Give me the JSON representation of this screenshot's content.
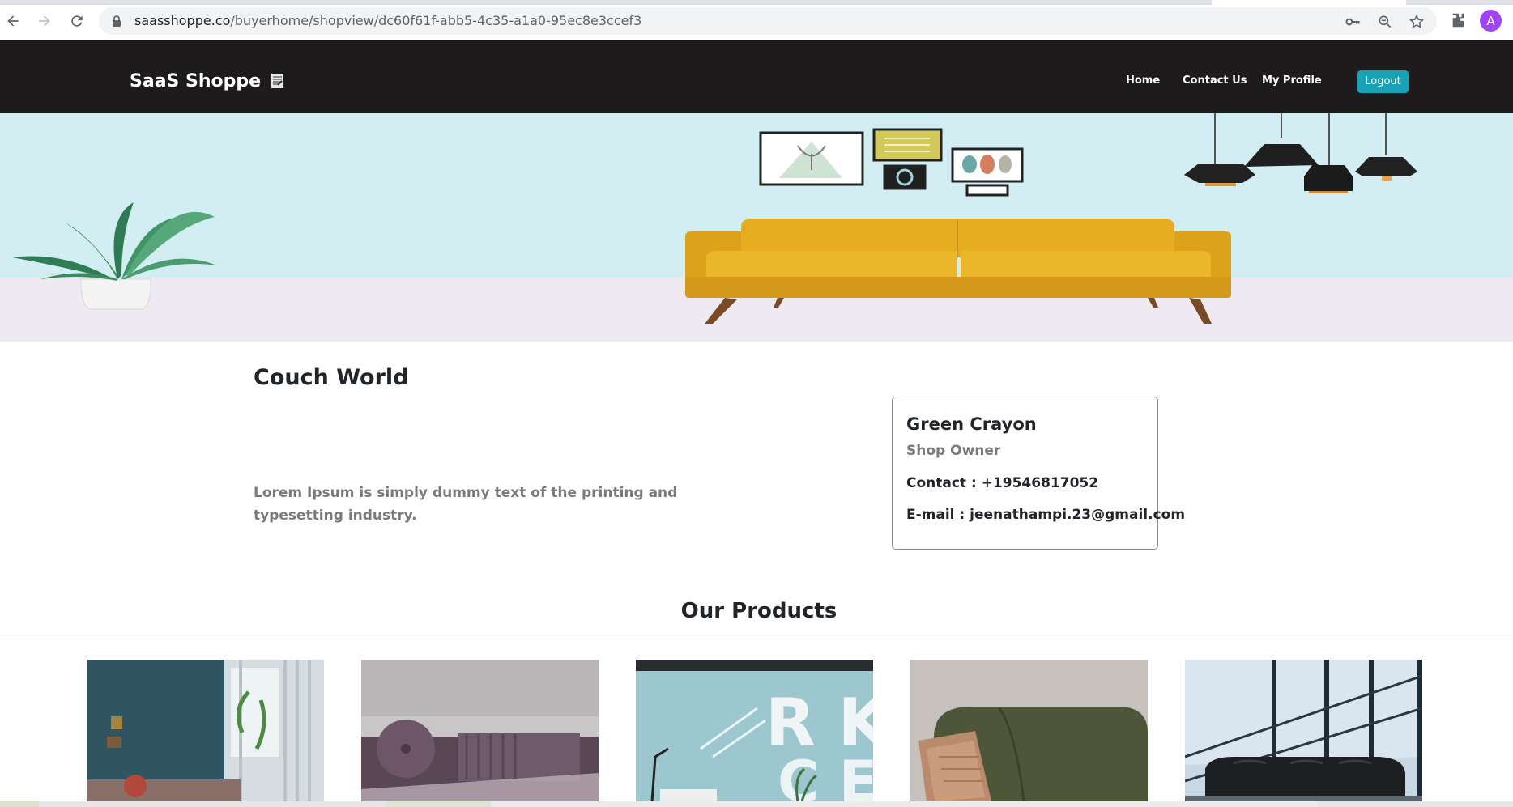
{
  "browser": {
    "url_host": "saasshoppe.co",
    "url_path": "/buyerhome/shopview/dc60f61f-abb5-4c35-a1a0-95ec8e3ccef3",
    "profile_initial": "A",
    "icons": [
      "back-icon",
      "forward-icon",
      "reload-icon",
      "lock-icon",
      "key-icon",
      "zoom-out-icon",
      "star-icon",
      "puzzle-icon"
    ]
  },
  "navbar": {
    "brand": "SaaS Shoppe",
    "links": [
      "Home",
      "Contact Us",
      "My Profile"
    ],
    "logout_label": "Logout",
    "accent_color": "#17a2b8",
    "background_color": "#1d1b1b"
  },
  "shop": {
    "name": "Couch World",
    "description": "Lorem Ipsum is simply dummy text of the printing and typesetting industry."
  },
  "owner": {
    "name": "Green Crayon",
    "role": "Shop Owner",
    "contact": "Contact : +19546817052",
    "email": "E-mail : jeenathampi.23@gmail.com"
  },
  "products": {
    "title": "Our Products",
    "images": [
      "teal-room-with-plants",
      "purple-velvet-sofa",
      "glass-office-wall",
      "green-sofa-with-pillow",
      "dark-sofa-by-window"
    ]
  }
}
